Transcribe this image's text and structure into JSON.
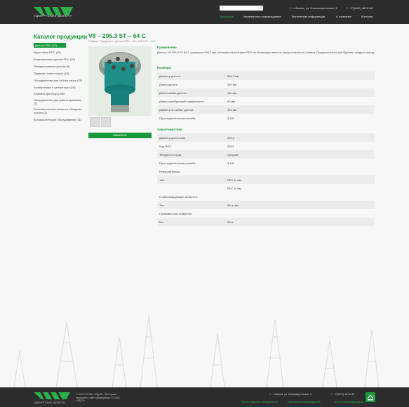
{
  "colors": {
    "accent": "#1a9a3c",
    "header_bg": "#2d2d2d"
  },
  "header": {
    "logo_text": "УДМУРТСКИЕ ДОЛОТА",
    "search": {
      "placeholder": "",
      "icon": "search-icon"
    },
    "address": "г. Ижевск, ул. Новосмирновская, 9",
    "phone": "+7(3412) 48-32-88",
    "nav": [
      "Продукция",
      "Инженерное сопровождение",
      "Техническая информация",
      "О компании",
      "Контакты"
    ]
  },
  "sidebar": {
    "title": "Каталог продукции",
    "items": [
      "Долота PDC (27)",
      "Бурголовки PDC (59)",
      "Бицентричные долота PDC (52)",
      "Твердосплавные долота (5)",
      "Подвески известковые (15)",
      "Оборудование для отбора керна (25)",
      "Калибраторы и центраторы (20)",
      "Клапаны для БЦД (156)",
      "Оборудование для цементирования: (3)",
      "Технологическая оснастка обсадных колонн (3)",
      "Вспомогательное оборудование (31)"
    ]
  },
  "product": {
    "title": "V8 – 295.3 ST – 64 C",
    "breadcrumb": "Главная » Продукция » Долота PDC » V8 – 295.3 ST – 64 C",
    "order_button": "ЗАКАЗАТЬ",
    "application_title": "Применение",
    "application_text": "Долото V8-295,3 ST-64 C размером 295,3 мм, оснащенное резцами PDC из агломерированного (искусственного) алмаза. Предназначено для бурения средних пород.",
    "sizes_title": "Размеры",
    "sizes": [
      {
        "k": "Диаметр долота",
        "v": "295,3 мм"
      },
      {
        "k": "Длина долота",
        "v": "430 мм"
      },
      {
        "k": "Длина шейки долота",
        "v": "120 мм"
      },
      {
        "k": "Длина калибрующей поверхности",
        "v": "60 мм"
      },
      {
        "k": "Диаметр по шейке долота",
        "v": "155 мм"
      },
      {
        "k": "Присоединительная резьба",
        "v": "3-152"
      }
    ],
    "chars_title": "Характеристики",
    "chars": [
      {
        "k": "Диаметр долота,мм",
        "v": "295,3"
      },
      {
        "k": "Код IADC",
        "v": "S323"
      },
      {
        "k": "Твердость пород",
        "v": "Средние"
      },
      {
        "k": "Присоединительная резьба",
        "v": "3-152"
      },
      {
        "k": "Режущие резцы",
        "v": ""
      },
      {
        "k": "Тип:",
        "v": "PDC ø, мм"
      },
      {
        "k": "",
        "v": "PDC ø, мм"
      },
      {
        "k": "Стабилизирующие элементы",
        "v": ""
      },
      {
        "k": "Тип:",
        "v": "ВК ø, мм"
      },
      {
        "k": "Промывочные отверстия",
        "v": ""
      },
      {
        "k": "Вес",
        "v": "85 кг"
      }
    ]
  },
  "footer": {
    "logo_text": "УДМУРТСКИЕ ДОЛОТА",
    "copyright": "© 2016 СЗ ЗАО «УДОЛ». Все права защищены, сайт принадлежит СЗ ЗАО «УДОЛ»",
    "address": "г. Ижевск, ул. Новосмирновская, 9",
    "phone": "+7(3412) 48-32-88",
    "links": [
      "Каталог бурового оборудования",
      "Инженерное сопровождение",
      "Техническая информация"
    ]
  }
}
